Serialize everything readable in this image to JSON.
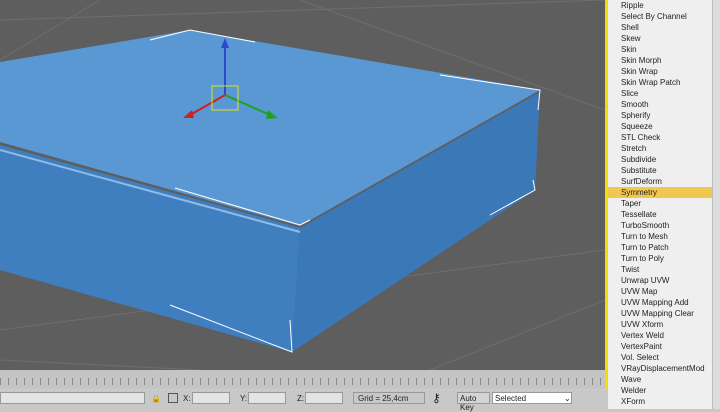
{
  "modifier_list": {
    "items": [
      "Ripple",
      "Select By Channel",
      "Shell",
      "Skew",
      "Skin",
      "Skin Morph",
      "Skin Wrap",
      "Skin Wrap Patch",
      "Slice",
      "Smooth",
      "Spherify",
      "Squeeze",
      "STL Check",
      "Stretch",
      "Subdivide",
      "Substitute",
      "SurfDeform",
      "Symmetry",
      "Taper",
      "Tessellate",
      "TurboSmooth",
      "Turn to Mesh",
      "Turn to Patch",
      "Turn to Poly",
      "Twist",
      "Unwrap UVW",
      "UVW Map",
      "UVW Mapping Add",
      "UVW Mapping Clear",
      "UVW Xform",
      "Vertex Weld",
      "VertexPaint",
      "Vol. Select",
      "VRayDisplacementMod",
      "Wave",
      "Welder",
      "XForm"
    ],
    "selected": "Symmetry",
    "highlight_color": "#f0c850"
  },
  "status": {
    "x_label": "X:",
    "y_label": "Y:",
    "z_label": "Z:",
    "x": "",
    "y": "",
    "z": "",
    "grid": "Grid = 25,4cm",
    "auto_key": "Auto Key",
    "key_filter": "Selected"
  },
  "colors": {
    "object": "#4a8ed0",
    "viewport": "#5e5e5e",
    "active_border": "#f0e000"
  }
}
